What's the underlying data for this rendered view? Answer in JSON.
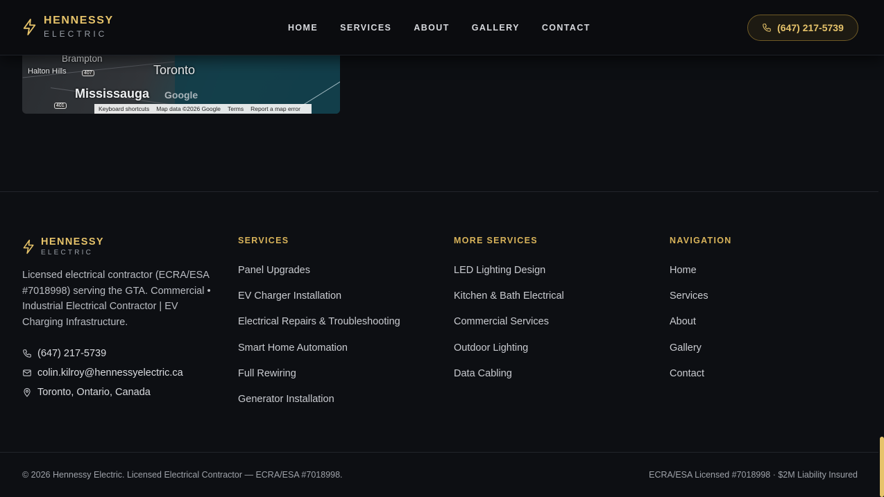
{
  "header": {
    "logo_name": "HENNESSY",
    "logo_sub": "ELECTRIC",
    "nav": [
      "HOME",
      "SERVICES",
      "ABOUT",
      "GALLERY",
      "CONTACT"
    ],
    "phone": "(647) 217-5739"
  },
  "map": {
    "labels": [
      "Brampton",
      "Toronto",
      "Halton Hills",
      "Mississauga"
    ],
    "shields": [
      "407",
      "401"
    ],
    "google": "Google",
    "footer": [
      "Keyboard shortcuts",
      "Map data ©2026 Google",
      "Terms",
      "Report a map error"
    ]
  },
  "footer": {
    "logo_name": "HENNESSY",
    "logo_sub": "ELECTRIC",
    "about": "Licensed electrical contractor (ECRA/ESA #7018998) serving the GTA. Commercial • Industrial Electrical Contractor | EV Charging Infrastructure.",
    "phone": "(647) 217-5739",
    "email": "colin.kilroy@hennessyelectric.ca",
    "location": "Toronto, Ontario, Canada",
    "services_title": "SERVICES",
    "services": [
      "Panel Upgrades",
      "EV Charger Installation",
      "Electrical Repairs & Troubleshooting",
      "Smart Home Automation",
      "Full Rewiring",
      "Generator Installation"
    ],
    "more_title": "MORE SERVICES",
    "more": [
      "LED Lighting Design",
      "Kitchen & Bath Electrical",
      "Commercial Services",
      "Outdoor Lighting",
      "Data Cabling"
    ],
    "nav_title": "NAVIGATION",
    "nav": [
      "Home",
      "Services",
      "About",
      "Gallery",
      "Contact"
    ],
    "copyright": "© 2026 Hennessy Electric. Licensed Electrical Contractor — ECRA/ESA #7018998.",
    "license": "ECRA/ESA Licensed #7018998 · $2M Liability Insured"
  },
  "colors": {
    "accent": "#e6c36a",
    "background": "#0d0f13"
  }
}
